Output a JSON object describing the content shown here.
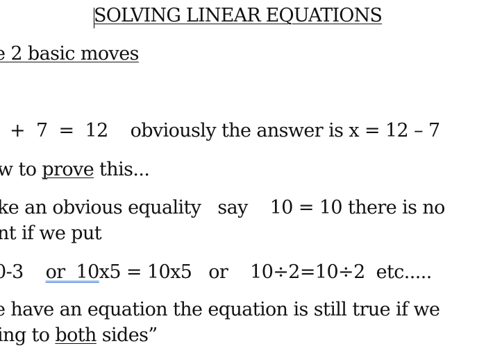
{
  "document": {
    "title": "SOLVING LINEAR EQUATIONS",
    "lines": [
      {
        "text": "e 2 basic moves"
      },
      {
        "text": "  +  7  =  12    obviously the answer is x = 12 – 7"
      },
      {
        "pre": "w to ",
        "underlined": "prove",
        "post": " this..."
      },
      {
        "text": "ke an obvious equality   say    10 = 10 there is no"
      },
      {
        "text": "nt if we put"
      },
      {
        "pre": "0-3    ",
        "grammar_flagged": "or  10",
        "post": "x5 = 10x5   or    10÷2=10÷2  etc....."
      },
      {
        "text": "e have an equation the equation is still true if we"
      },
      {
        "pre": "ing to ",
        "underlined": "both",
        "post": " sides”"
      }
    ]
  },
  "colors": {
    "grammar_underline": "#3c78d8",
    "text": "#111111",
    "background": "#ffffff"
  }
}
